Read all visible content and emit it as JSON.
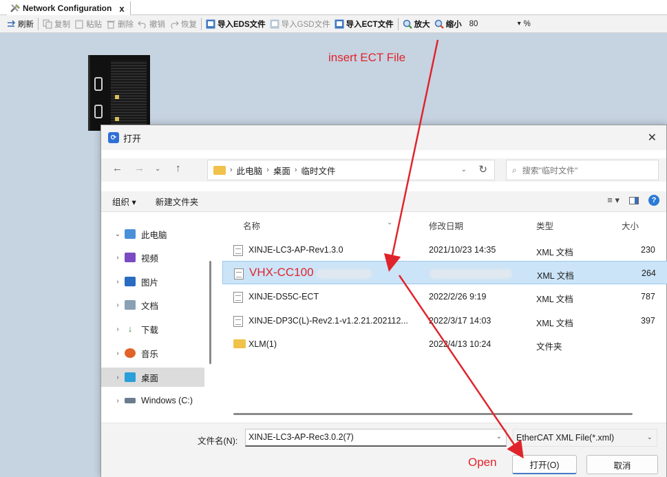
{
  "window": {
    "tab_title": "Network Configuration",
    "tab_close": "x"
  },
  "toolbar": {
    "items": [
      {
        "label": "刷新",
        "icon": "refresh-icon",
        "enabled": true
      },
      {
        "label": "复制",
        "icon": "copy-icon",
        "enabled": false
      },
      {
        "label": "粘贴",
        "icon": "paste-icon",
        "enabled": false
      },
      {
        "label": "删除",
        "icon": "delete-icon",
        "enabled": false
      },
      {
        "label": "撤销",
        "icon": "undo-icon",
        "enabled": false
      },
      {
        "label": "恢复",
        "icon": "redo-icon",
        "enabled": false
      },
      {
        "label": "导入EDS文件",
        "icon": "import-icon",
        "enabled": true
      },
      {
        "label": "导入GSD文件",
        "icon": "import-icon",
        "enabled": false
      },
      {
        "label": "导入ECT文件",
        "icon": "import-icon",
        "enabled": true
      },
      {
        "label": "放大",
        "icon": "zoom-in-icon",
        "enabled": true
      },
      {
        "label": "缩小",
        "icon": "zoom-out-icon",
        "enabled": true
      }
    ],
    "zoom_value": "80",
    "zoom_unit": "%"
  },
  "annotations": {
    "insert_ect": "insert ECT File",
    "open": "Open",
    "color": "#e0242b"
  },
  "dialog": {
    "title": "打开",
    "close": "✕",
    "breadcrumb": [
      "此电脑",
      "桌面",
      "临时文件"
    ],
    "search_placeholder": "搜索\"临时文件\"",
    "commands": {
      "organize": "组织 ▾",
      "new_folder": "新建文件夹"
    },
    "tree": [
      {
        "label": "此电脑",
        "icon": "pc-icon",
        "expanded": true
      },
      {
        "label": "视频",
        "icon": "video-icon"
      },
      {
        "label": "图片",
        "icon": "picture-icon"
      },
      {
        "label": "文档",
        "icon": "document-icon"
      },
      {
        "label": "下载",
        "icon": "download-icon"
      },
      {
        "label": "音乐",
        "icon": "music-icon"
      },
      {
        "label": "桌面",
        "icon": "desktop-icon",
        "selected": true
      },
      {
        "label": "Windows (C:)",
        "icon": "drive-icon"
      }
    ],
    "columns": {
      "name": "名称",
      "date": "修改日期",
      "type": "类型",
      "size": "大小"
    },
    "files": [
      {
        "name": "XINJE-LC3-AP-Rev1.3.0",
        "date": "2021/10/23 14:35",
        "type": "XML 文档",
        "size": "230",
        "kind": "xml"
      },
      {
        "name": "VHX-CC100",
        "date": "",
        "type": "XML 文档",
        "size": "264",
        "kind": "xml",
        "selected": true
      },
      {
        "name": "XINJE-DS5C-ECT",
        "date": "2022/2/26 9:19",
        "type": "XML 文档",
        "size": "787",
        "kind": "xml"
      },
      {
        "name": "XINJE-DP3C(L)-Rev2.1-v1.2.21.202112...",
        "date": "2022/3/17 14:03",
        "type": "XML 文档",
        "size": "397",
        "kind": "xml"
      },
      {
        "name": "XLM(1)",
        "date": "2022/4/13 10:24",
        "type": "文件夹",
        "size": "",
        "kind": "folder"
      }
    ],
    "filename_label": "文件名(N):",
    "filename_value": "XINJE-LC3-AP-Rec3.0.2(7)",
    "filetype_value": "EtherCAT  XML  File(*.xml)",
    "open_button": "打开(O)",
    "cancel_button": "取消"
  }
}
